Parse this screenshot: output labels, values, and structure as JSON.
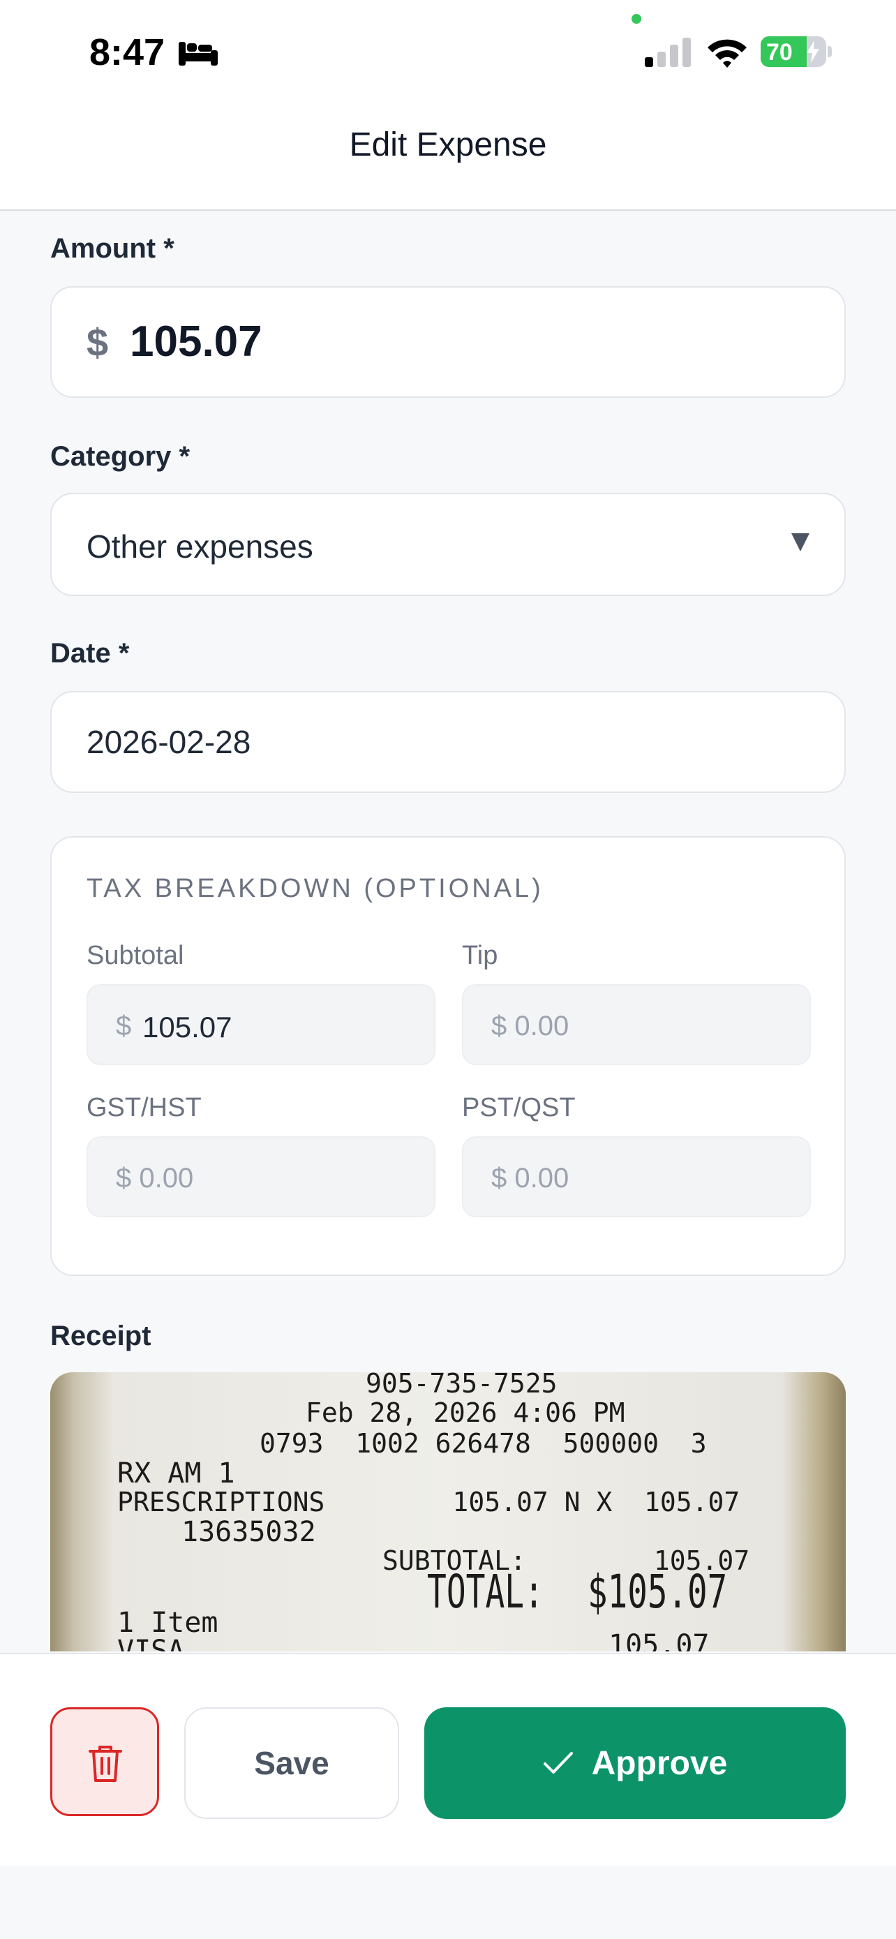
{
  "status_bar": {
    "time": "8:47",
    "battery_level": 70,
    "battery_label": "70",
    "icons": [
      "bed-icon",
      "signal-icon",
      "wifi-icon",
      "battery-icon",
      "charging-bolt-icon"
    ]
  },
  "header": {
    "title": "Edit Expense"
  },
  "form": {
    "amount": {
      "label": "Amount *",
      "currency": "$",
      "value": "105.07"
    },
    "category": {
      "label": "Category *",
      "selected": "Other expenses"
    },
    "date": {
      "label": "Date *",
      "value": "2026-02-28"
    },
    "tax": {
      "title": "TAX BREAKDOWN (OPTIONAL)",
      "subtotal": {
        "label": "Subtotal",
        "currency": "$",
        "value": "105.07"
      },
      "tip": {
        "label": "Tip",
        "placeholder": "$ 0.00"
      },
      "gst_hst": {
        "label": "GST/HST",
        "placeholder": "$ 0.00"
      },
      "pst_qst": {
        "label": "PST/QST",
        "placeholder": "$ 0.00"
      }
    },
    "receipt": {
      "label": "Receipt",
      "lines": [
        "905-735-7525",
        "Feb 28, 2026 4:06 PM",
        "0793  1002 626478  500000  3",
        "RX AM 1",
        "PRESCRIPTIONS        105.07 N X  105.07",
        "13635032",
        "SUBTOTAL:        105.07",
        "TOTAL:",
        "$105.07",
        "1 Item",
        "VISA",
        "105.07"
      ]
    }
  },
  "actions": {
    "delete_icon": "trash-icon",
    "save_label": "Save",
    "approve_label": "Approve",
    "approve_icon": "checkmark-icon"
  },
  "colors": {
    "accent": "#0c9468",
    "danger": "#dc2626",
    "background": "#f7f8fa"
  }
}
